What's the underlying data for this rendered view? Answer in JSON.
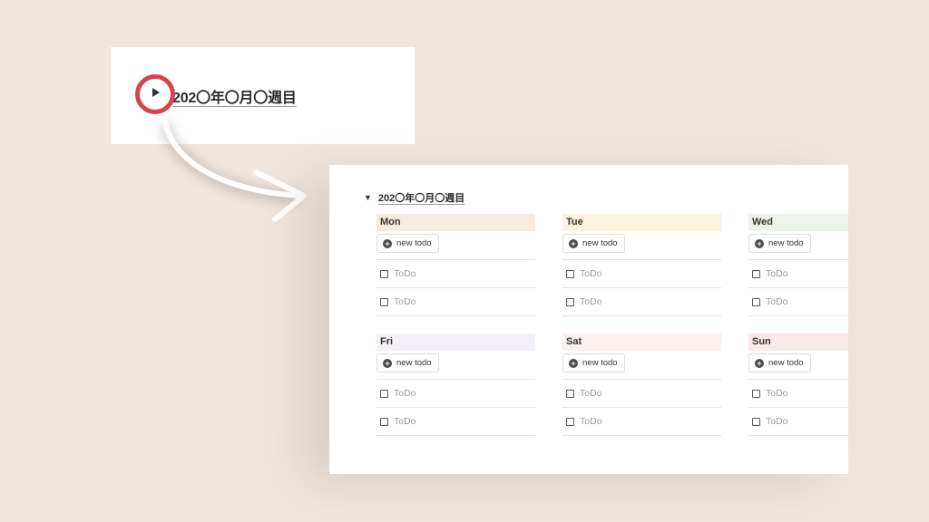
{
  "toggle_card": {
    "title": "202〇年〇月〇週目",
    "toggle_icon": "play-triangle-icon"
  },
  "expanded_card": {
    "title": "202〇年〇月〇週目",
    "days": [
      {
        "name": "Mon",
        "color": "#f5ebe0",
        "new_label": "new todo",
        "todos": [
          "ToDo",
          "ToDo"
        ]
      },
      {
        "name": "Tue",
        "color": "#fbf3db",
        "new_label": "new todo",
        "todos": [
          "ToDo",
          "ToDo"
        ]
      },
      {
        "name": "Wed",
        "color": "#edf3ec",
        "new_label": "new todo",
        "todos": [
          "ToDo",
          "ToDo"
        ]
      },
      {
        "name": "Fri",
        "color": "#f4f0f7",
        "new_label": "new todo",
        "todos": [
          "ToDo",
          "ToDo"
        ]
      },
      {
        "name": "Sat",
        "color": "#faf0ee",
        "new_label": "new todo",
        "todos": [
          "ToDo",
          "ToDo"
        ]
      },
      {
        "name": "Sun",
        "color": "#fbe9e9",
        "new_label": "new todo",
        "todos": [
          "ToDo",
          "ToDo"
        ]
      }
    ]
  },
  "colors": {
    "background": "#efe6df",
    "highlight_ring": "#d9434c"
  }
}
